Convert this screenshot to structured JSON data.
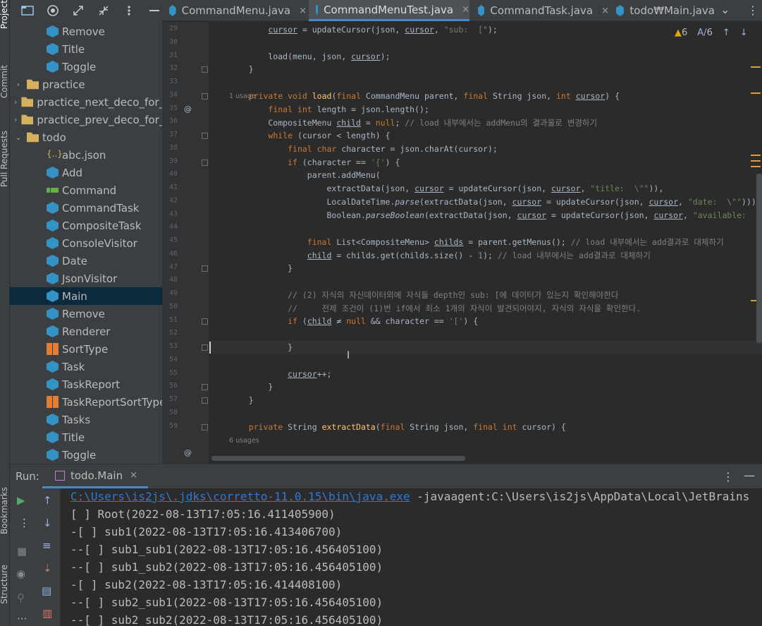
{
  "left_strip": {
    "project": "Project",
    "commit": "Commit",
    "pull_requests": "Pull Requests",
    "bookmarks": "Bookmarks",
    "structure": "Structure"
  },
  "project_toolbar": {
    "icons": [
      "folder-icon",
      "target-icon",
      "expand-icon",
      "collapse-icon",
      "more-icon",
      "minimize-icon"
    ]
  },
  "tree": [
    {
      "label": "Remove",
      "icon": "class",
      "depth": 3
    },
    {
      "label": "Title",
      "icon": "class",
      "depth": 3
    },
    {
      "label": "Toggle",
      "icon": "class",
      "depth": 3
    },
    {
      "label": "practice",
      "icon": "folder",
      "depth": 1,
      "arrow": "›"
    },
    {
      "label": "practice_next_deco_for_a",
      "icon": "folder",
      "depth": 1,
      "arrow": "›"
    },
    {
      "label": "practice_prev_deco_for_s",
      "icon": "folder",
      "depth": 1,
      "arrow": "›"
    },
    {
      "label": "todo",
      "icon": "folder",
      "depth": 1,
      "arrow": "⌄"
    },
    {
      "label": "abc.json",
      "icon": "json",
      "depth": 2
    },
    {
      "label": "Add",
      "icon": "class",
      "depth": 2
    },
    {
      "label": "Command",
      "icon": "interface",
      "depth": 2
    },
    {
      "label": "CommandTask",
      "icon": "class",
      "depth": 2
    },
    {
      "label": "CompositeTask",
      "icon": "class",
      "depth": 2
    },
    {
      "label": "ConsoleVisitor",
      "icon": "class",
      "depth": 2
    },
    {
      "label": "Date",
      "icon": "class",
      "depth": 2
    },
    {
      "label": "JsonVisitor",
      "icon": "class",
      "depth": 2
    },
    {
      "label": "Main",
      "icon": "class",
      "depth": 2,
      "selected": true
    },
    {
      "label": "Remove",
      "icon": "class",
      "depth": 2
    },
    {
      "label": "Renderer",
      "icon": "class",
      "depth": 2
    },
    {
      "label": "SortType",
      "icon": "enum",
      "depth": 2
    },
    {
      "label": "Task",
      "icon": "class",
      "depth": 2
    },
    {
      "label": "TaskReport",
      "icon": "class",
      "depth": 2
    },
    {
      "label": "TaskReportSortType",
      "icon": "enum",
      "depth": 2
    },
    {
      "label": "Tasks",
      "icon": "class",
      "depth": 2
    },
    {
      "label": "Title",
      "icon": "class",
      "depth": 2
    },
    {
      "label": "Toggle",
      "icon": "class",
      "depth": 2
    }
  ],
  "tabs": [
    {
      "label": "CommandMenu.java",
      "close": "×",
      "active": false
    },
    {
      "label": "CommandMenuTest.java",
      "close": "×",
      "active": true
    },
    {
      "label": "CommandTask.java",
      "close": "×",
      "active": false
    },
    {
      "label": "todo₩Main.java",
      "close": "",
      "active": false
    }
  ],
  "tab_overflow": "⌄",
  "tab_more": "⋮",
  "inspections": {
    "warnings": "6",
    "typos": "6"
  },
  "code_lines": [
    {
      "n": "29",
      "html": "        <span class='u'>cursor</span> = updateCursor(json, <span class='u'>cursor</span>, <span class='s'>\"sub:  [\"</span>);"
    },
    {
      "n": "30",
      "html": ""
    },
    {
      "n": "31",
      "html": "        load(menu, json, <span class='u'>cursor</span>);"
    },
    {
      "n": "32",
      "html": "    }"
    },
    {
      "n": "33",
      "html": ""
    },
    {
      "n": "34",
      "html": "    <span class='k'>private void</span> <span class='m'>load</span>(<span class='k'>final</span> CommandMenu parent, <span class='k'>final</span> String json, <span class='k'>int</span> <span class='u'>cursor</span>) {"
    },
    {
      "n": "35",
      "html": "        <span class='k'>final int</span> length = json.length();"
    },
    {
      "n": "36",
      "html": "        CompositeMenu <span class='u'>child</span> = <span class='k'>null</span>; <span class='c'>// load 내부에서는 addMenu의 결과물로 변경하기</span>"
    },
    {
      "n": "37",
      "html": "        <span class='k'>while</span> (cursor &lt; length) {"
    },
    {
      "n": "38",
      "html": "            <span class='k'>final char</span> character = json.charAt(cursor);"
    },
    {
      "n": "39",
      "html": "            <span class='k'>if</span> (character == <span class='s'>'{'</span>) {"
    },
    {
      "n": "40",
      "html": "                parent.addMenu("
    },
    {
      "n": "41",
      "html": "                    extractData(json, <span class='u'>cursor</span> = updateCursor(json, <span class='u'>cursor</span>, <span class='s'>\"title:  \\\"\"</span>)),"
    },
    {
      "n": "42",
      "html": "                    LocalDateTime.<span class='i'>parse</span>(extractData(json, <span class='u'>cursor</span> = updateCursor(json, <span class='u'>cursor</span>, <span class='s'>\"date:  \\\"\"</span>))),"
    },
    {
      "n": "43",
      "html": "                    Boolean.<span class='i'>parseBoolean</span>(extractData(json, <span class='u'>cursor</span> = updateCursor(json, <span class='u'>cursor</span>, <span class='s'>\"available:  \\\"\"</span>)"
    },
    {
      "n": "44",
      "html": ""
    },
    {
      "n": "45",
      "html": "                <span class='k'>final</span> List&lt;CompositeMenu&gt; <span class='u'>childs</span> = parent.getMenus(); <span class='c'>// load 내부에서는 add결과로 대체하기</span>"
    },
    {
      "n": "46",
      "html": "                <span class='u'>child</span> = childs.get(childs.size() - <span class='n'>1</span>); <span class='c'>// load 내부에서는 add결과로 대체하기</span>"
    },
    {
      "n": "47",
      "html": "            }"
    },
    {
      "n": "48",
      "html": ""
    },
    {
      "n": "49",
      "html": "            <span class='c'>// (2) 자식의 자신데이터외에 자식들 depth인 sub: [에 데이터가 있는지 확인해야한다</span>"
    },
    {
      "n": "50",
      "html": "            <span class='c'>//     전제 조건이 (1)번 if에서 최소 1개의 자식이 발견되어야지, 자식의 자식을 확인한다.</span>"
    },
    {
      "n": "51",
      "html": "            <span class='k'>if</span> (<span class='u'>child</span> ≠ <span class='k'>null</span> &amp;&amp; character == <span class='s'>'['</span>) {"
    },
    {
      "n": "52",
      "html": ""
    },
    {
      "n": "53",
      "html": "            }"
    },
    {
      "n": "54",
      "html": ""
    },
    {
      "n": "55",
      "html": "            <span class='u'>cursor</span>++;"
    },
    {
      "n": "56",
      "html": "        }"
    },
    {
      "n": "57",
      "html": "    }"
    },
    {
      "n": "58",
      "html": ""
    },
    {
      "n": "59",
      "html": "    <span class='k'>private</span> String <span class='m'>extractData</span>(<span class='k'>final</span> String json, <span class='k'>final int</span> cursor) {"
    }
  ],
  "usages": {
    "load": "1 usage",
    "extract": "6 usages"
  },
  "run": {
    "label": "Run:",
    "tab": "todo.Main",
    "tab_close": "×",
    "more": "⋮",
    "minimize": "—",
    "cmd_link": "C:\\Users\\is2js\\.jdks\\corretto-11.0.15\\bin\\java.exe",
    "cmd_rest": " -javaagent:C:\\Users\\is2js\\AppData\\Local\\JetBrains",
    "output": [
      "[ ] Root(2022-08-13T17:05:16.411405900)",
      "-[ ] sub1(2022-08-13T17:05:16.413406700)",
      "--[ ] sub1_sub1(2022-08-13T17:05:16.456405100)",
      "--[ ] sub1_sub2(2022-08-13T17:05:16.456405100)",
      "-[ ] sub2(2022-08-13T17:05:16.414408100)",
      "--[ ] sub2_sub1(2022-08-13T17:05:16.456405100)",
      "--[ ] sub2_sub2(2022-08-13T17:05:16.456405100)"
    ]
  }
}
